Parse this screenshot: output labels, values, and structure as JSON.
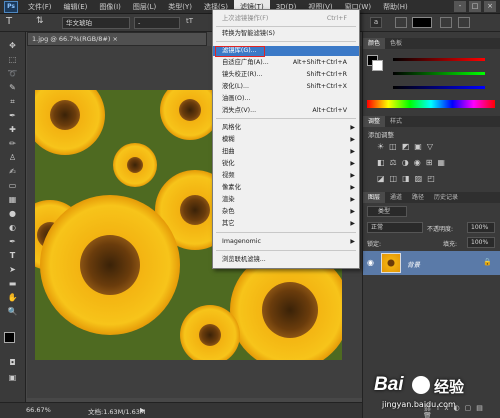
{
  "menubar": {
    "logo": "Ps",
    "items": [
      "文件(F)",
      "编辑(E)",
      "图像(I)",
      "图层(L)",
      "类型(Y)",
      "选择(S)",
      "滤镜(T)",
      "3D(D)",
      "视图(V)",
      "窗口(W)",
      "帮助(H)"
    ],
    "active_index": 6,
    "window_buttons": [
      "-",
      "□",
      "×"
    ]
  },
  "options": {
    "type_tool": "T",
    "font_family": "华文琥珀",
    "font_style": "-",
    "size_icon": "tT",
    "aa": "a"
  },
  "document": {
    "tab_title": "1.jpg @ 66.7%(RGB/8#) ×",
    "zoom": "66.67%",
    "doc_info": "文档:1.63M/1.63M"
  },
  "filter_menu": {
    "items": [
      {
        "label": "上次滤镜操作(F)",
        "shortcut": "Ctrl+F",
        "disabled": true
      },
      {
        "label": "转换为智能滤镜(S)",
        "shortcut": ""
      },
      {
        "label": "滤镜库(G)...",
        "shortcut": "",
        "highlighted": true
      },
      {
        "label": "自适应广角(A)...",
        "shortcut": "Alt+Shift+Ctrl+A"
      },
      {
        "label": "镜头校正(R)...",
        "shortcut": "Shift+Ctrl+R"
      },
      {
        "label": "液化(L)...",
        "shortcut": "Shift+Ctrl+X"
      },
      {
        "label": "油画(O)...",
        "shortcut": ""
      },
      {
        "label": "消失点(V)...",
        "shortcut": "Alt+Ctrl+V"
      },
      {
        "label": "风格化",
        "submenu": true
      },
      {
        "label": "模糊",
        "submenu": true
      },
      {
        "label": "扭曲",
        "submenu": true
      },
      {
        "label": "锐化",
        "submenu": true
      },
      {
        "label": "视频",
        "submenu": true
      },
      {
        "label": "像素化",
        "submenu": true
      },
      {
        "label": "渲染",
        "submenu": true
      },
      {
        "label": "杂色",
        "submenu": true
      },
      {
        "label": "其它",
        "submenu": true
      },
      {
        "label": "Imagenomic",
        "submenu": true
      },
      {
        "label": "浏览联机滤镜...",
        "shortcut": ""
      }
    ]
  },
  "panels": {
    "color_tabs": [
      "颜色",
      "色板"
    ],
    "adjust_tabs": [
      "调整",
      "样式"
    ],
    "adjust_title": "添加调整",
    "layers_tabs": [
      "图层",
      "通道",
      "路径",
      "历史记录"
    ],
    "kind_label": "类型",
    "blend_mode": "正常",
    "opacity_label": "不透明度:",
    "opacity_value": "100%",
    "lock_label": "锁定:",
    "fill_label": "填充:",
    "fill_value": "100%",
    "layer_name": "背景"
  },
  "watermark": {
    "brand": "Bai",
    "brand2": "经验",
    "url": "jingyan.baidu.com"
  },
  "colors": {
    "highlight": "#3b79c7",
    "red_box": "#e12424"
  }
}
